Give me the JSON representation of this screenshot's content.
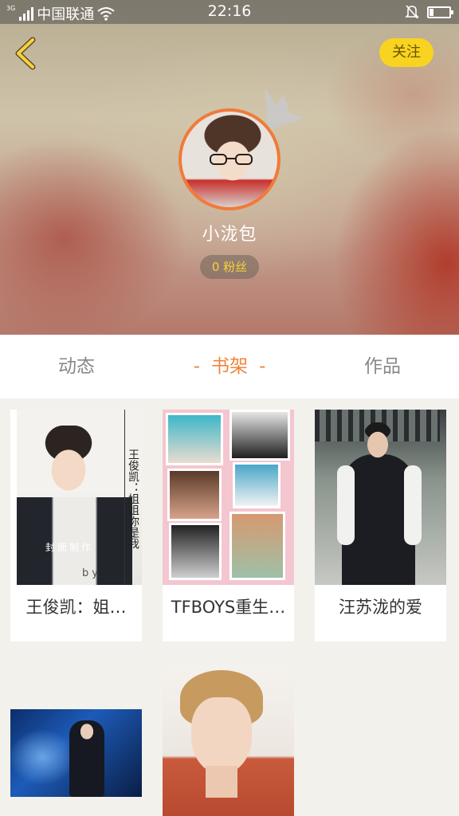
{
  "status_bar": {
    "network_tag": "3G",
    "carrier": "中国联通",
    "time": "22:16",
    "icons": [
      "signal-icon",
      "wifi-icon",
      "mute-icon",
      "battery-icon"
    ]
  },
  "header": {
    "follow_label": "关注",
    "username": "小泷包",
    "fans_label": "0 粉丝",
    "accent": "#f0843c",
    "follow_color": "#f8d320"
  },
  "tabs": [
    {
      "label": "动态"
    },
    {
      "label": "书架",
      "active": true
    },
    {
      "label": "作品"
    }
  ],
  "tab_dash": "-",
  "books": [
    {
      "title": "王俊凯：姐…",
      "cover_side_text": "王俊凯：姐姐你是我",
      "cover_caption": "封面制作",
      "cover_by": "by"
    },
    {
      "title": "TFBOYS重生…"
    },
    {
      "title": "汪苏泷的爱"
    },
    {
      "title": ""
    },
    {
      "title": ""
    }
  ]
}
